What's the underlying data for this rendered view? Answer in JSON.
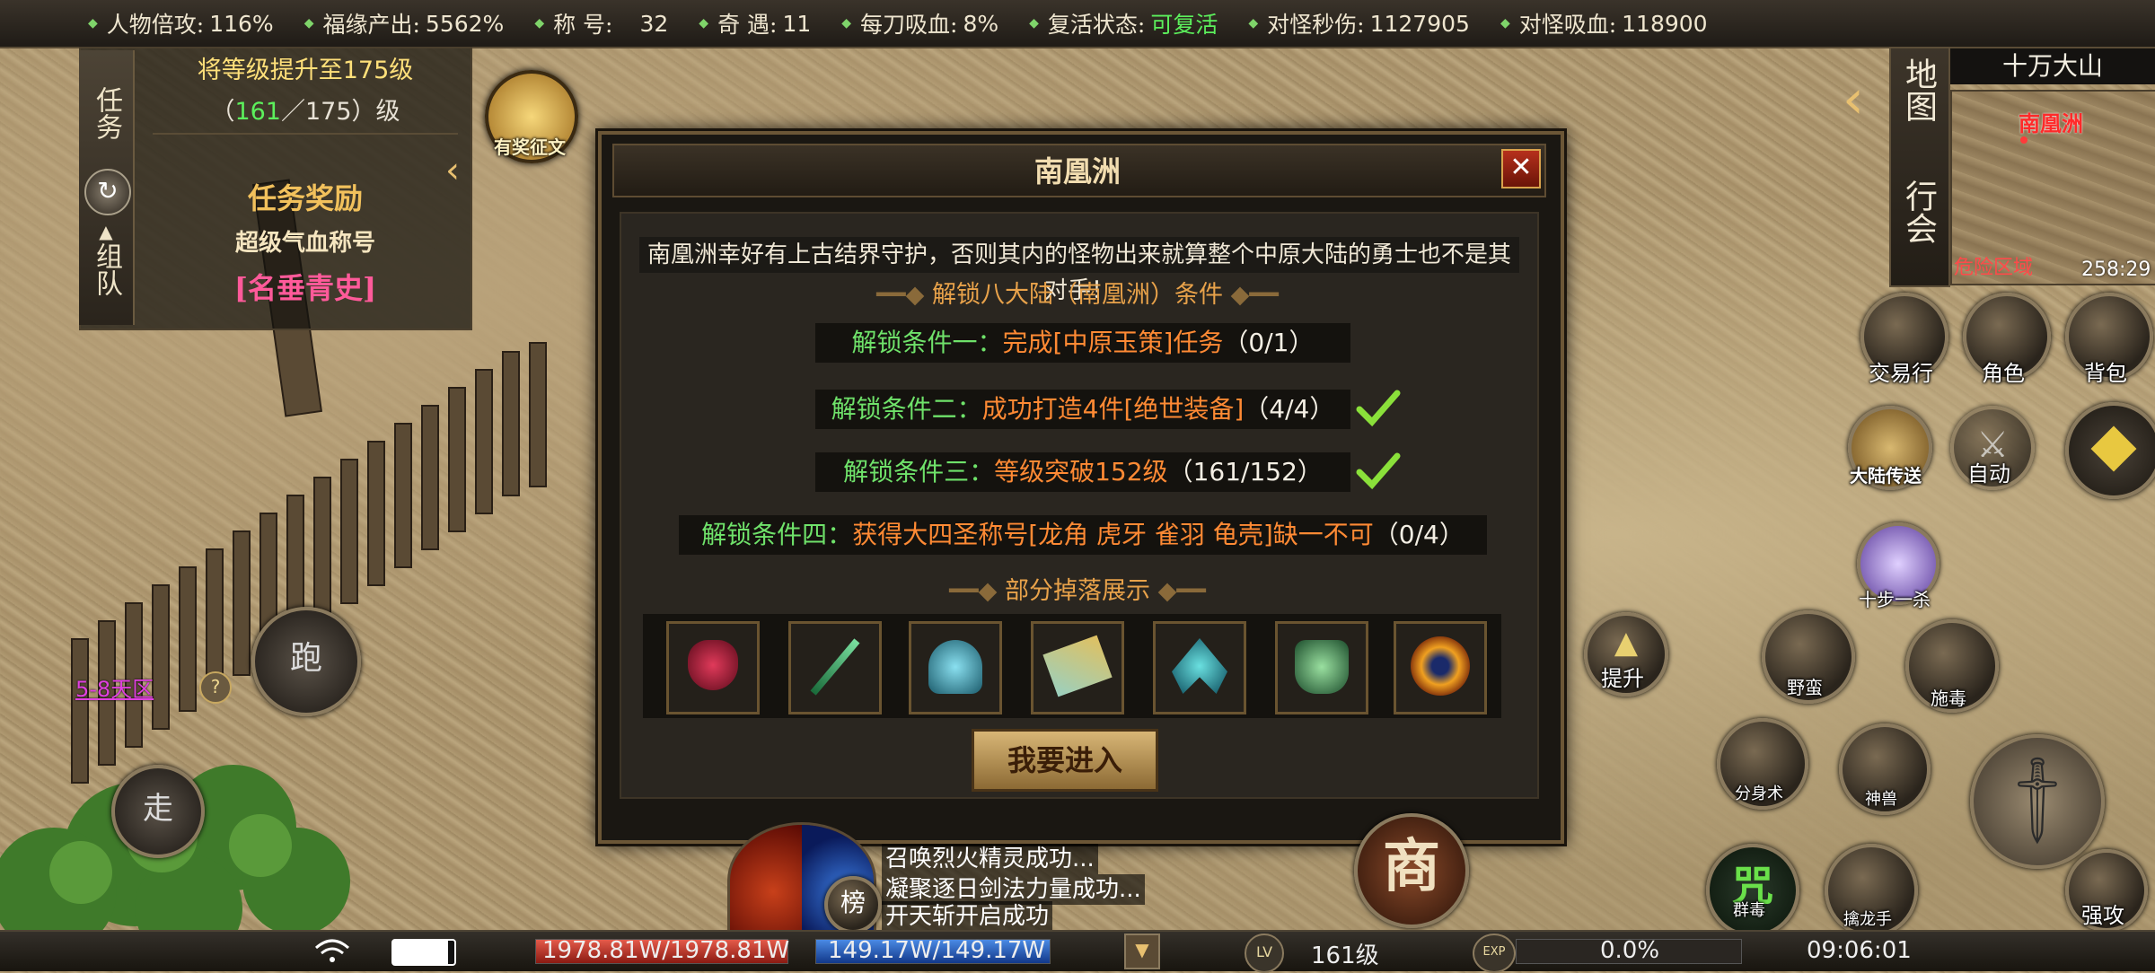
{
  "top_stats": [
    {
      "label": "人物倍攻:",
      "value": "116%"
    },
    {
      "label": "福缘产出:",
      "value": "5562%"
    },
    {
      "label": "称 号:",
      "value": "32"
    },
    {
      "label": "奇 遇:",
      "value": "11"
    },
    {
      "label": "每刀吸血:",
      "value": "8%"
    },
    {
      "label": "复活状态:",
      "value": "可复活"
    },
    {
      "label": "对怪秒伤:",
      "value": "1127905"
    },
    {
      "label": "对怪吸血:",
      "value": "118900"
    }
  ],
  "quest": {
    "tab_task": "任务",
    "tab_team": "组队",
    "goal": "将等级提升至175级",
    "progress_open": "（",
    "progress_current": "161",
    "progress_sep": "／175）级",
    "reward_label": "任务奖励",
    "reward_title": "超级气血称号",
    "reward_name": "[名垂青史]"
  },
  "event_label": "有奖征文",
  "dialog": {
    "title": "南凰洲",
    "close": "✕",
    "description": "南凰洲幸好有上古结界守护，否则其内的怪物出来就算整个中原大陆的勇士也不是其对手！",
    "unlock_title": "解锁八大陆（南凰洲）条件",
    "conditions": [
      {
        "label": "解锁条件一：",
        "text": "完成[中原玉策]任务",
        "count": "（0/1）",
        "done": false
      },
      {
        "label": "解锁条件二：",
        "text": "成功打造4件[绝世装备]",
        "count": "（4/4）",
        "done": true
      },
      {
        "label": "解锁条件三：",
        "text": "等级突破152级",
        "count": "（161/152）",
        "done": true
      },
      {
        "label": "解锁条件四：",
        "text": "获得大四圣称号[龙角 虎牙 雀羽 龟壳]缺一不可",
        "count": "（0/4）",
        "done": false
      }
    ],
    "loot_title": "部分掉落展示",
    "loot_items": [
      "mask-item",
      "staff-item",
      "helmet-item",
      "scroll-item",
      "claw-item",
      "cauldron-item",
      "orb-item"
    ],
    "enter_button": "我要进入"
  },
  "minimap": {
    "map_button": "地图",
    "guild_button": "行会",
    "area": "十万大山",
    "region_label": "南凰洲",
    "danger_label": "危险区域",
    "coords": "258:29"
  },
  "right_buttons": {
    "trade": "交易行",
    "role": "角色",
    "bag": "背包",
    "teleport": "大陆传送",
    "auto": "自动",
    "ten_step": "十步一杀",
    "upgrade": "提升",
    "wild_barb": "野蛮",
    "poison": "施毒",
    "clone": "分身术",
    "beast": "神兽",
    "group_poison": "群毒",
    "dragon_hand": "擒龙手",
    "strong_attack": "强攻",
    "curse_glyph": "咒",
    "shop_glyph": "商",
    "rank_glyph": "榜"
  },
  "left_controls": {
    "run": "跑",
    "walk": "走",
    "server": "5-8天区",
    "help": "?"
  },
  "chat": [
    "召唤烈火精灵成功...",
    "凝聚逐日剑法力量成功...",
    "开天斩开启成功"
  ],
  "bottom": {
    "hp": "1978.81W/1978.81W",
    "mp": "149.17W/149.17W",
    "lv_badge": "LV",
    "level": "161级",
    "exp_badge": "EXP",
    "exp": "0.0%",
    "time": "09:06:01",
    "hp_fill": 1.0,
    "mp_fill": 1.0
  },
  "colors": {
    "condition_label": "#6fe26a",
    "condition_text": "#ff8a34",
    "revive_status": "#5cf05c",
    "reward_name": "#ff5a9a"
  }
}
